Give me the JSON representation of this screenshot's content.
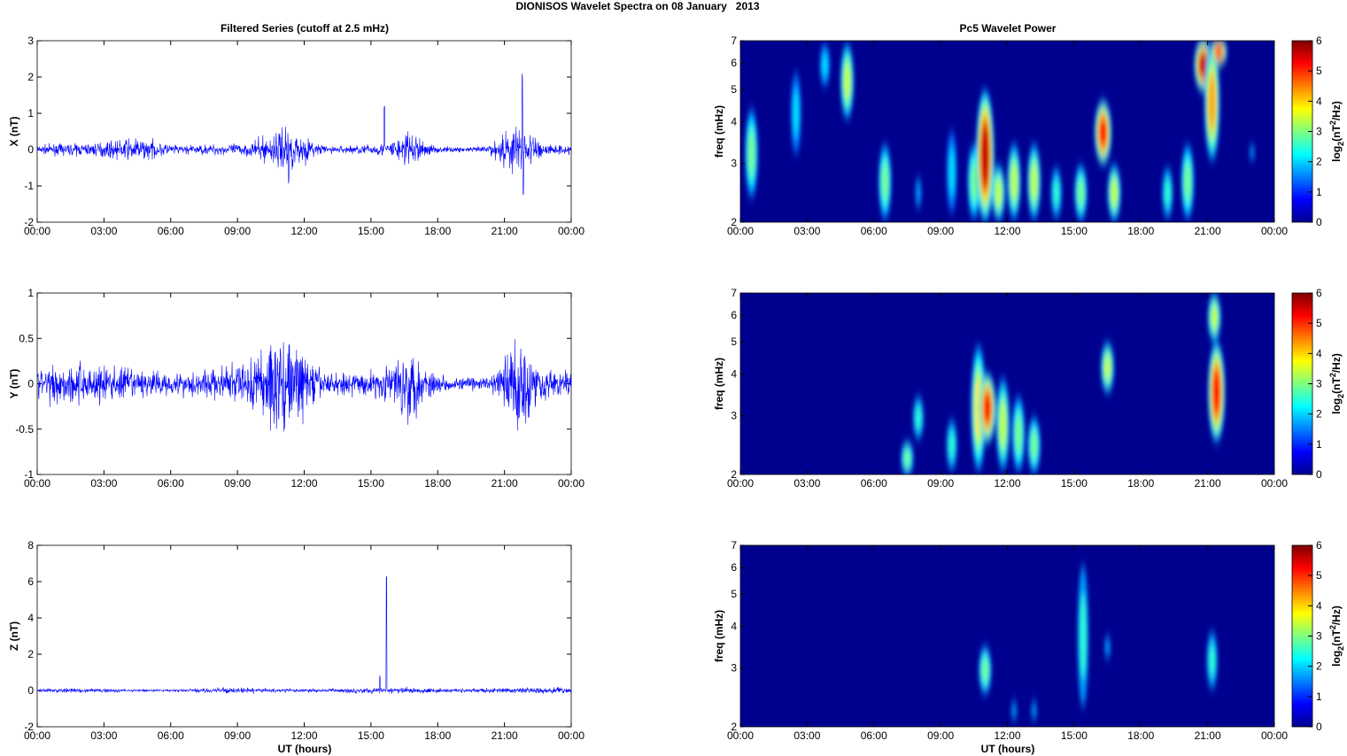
{
  "title": "DIONISOS Wavelet Spectra on 08 January   2013",
  "chart_data": {
    "left_title": "Filtered Series (cutoff at 2.5 mHz)",
    "right_title": "Pc5 Wavelet Power",
    "xlabel": "UT (hours)",
    "xticks": [
      "00:00",
      "03:00",
      "06:00",
      "09:00",
      "12:00",
      "15:00",
      "18:00",
      "21:00",
      "00:00"
    ],
    "xlim_hours": [
      0,
      24
    ],
    "freq_label": "freq (mHz)",
    "freq_ticks": [
      "2",
      "3",
      "4",
      "5",
      "6",
      "7"
    ],
    "freq_lim": [
      2,
      7
    ],
    "colorbar_label": "log2(nT2/Hz)",
    "colorbar_ticks": [
      "0",
      "1",
      "2",
      "3",
      "4",
      "5",
      "6"
    ],
    "colorbar_lim": [
      0,
      6
    ],
    "colormap": "jet",
    "line_color": "#0000ff",
    "panels": [
      {
        "component": "X",
        "ylabel": "X (nT)",
        "ylim": [
          -2,
          3
        ],
        "yticks": [
          "-2",
          "-1",
          "0",
          "1",
          "2",
          "3"
        ],
        "noise": 0.1,
        "bursts": [
          [
            11.2,
            0.8,
            0.45
          ],
          [
            15.6,
            0.02,
            1.1
          ],
          [
            16.7,
            0.5,
            0.3
          ],
          [
            21.5,
            0.6,
            0.5
          ],
          [
            21.8,
            0.05,
            2.0
          ],
          [
            21.85,
            0.05,
            -1.1
          ],
          [
            11.3,
            0.05,
            -0.9
          ],
          [
            4.5,
            1,
            0.2
          ]
        ],
        "spectrum": [
          [
            0.5,
            2.3,
            4.5,
            2.5
          ],
          [
            2.5,
            3,
            6,
            1.5
          ],
          [
            3.8,
            5,
            7,
            1.5
          ],
          [
            4.8,
            4,
            7,
            3
          ],
          [
            6.5,
            2,
            3.5,
            2.5
          ],
          [
            8,
            2,
            3,
            1
          ],
          [
            9.5,
            2,
            4,
            1.5
          ],
          [
            10.5,
            2,
            3.5,
            2.5
          ],
          [
            11,
            2,
            5,
            5.5
          ],
          [
            11.6,
            2,
            3,
            3
          ],
          [
            12.3,
            2,
            3.5,
            3
          ],
          [
            13.2,
            2,
            3.5,
            3
          ],
          [
            14.2,
            2,
            3,
            2
          ],
          [
            15.3,
            2,
            3,
            2.5
          ],
          [
            16.3,
            3,
            4.6,
            5
          ],
          [
            16.8,
            2,
            3,
            3
          ],
          [
            19.2,
            2,
            3,
            2
          ],
          [
            20.1,
            2,
            3.5,
            2.5
          ],
          [
            20.8,
            5,
            7,
            5.5
          ],
          [
            21.2,
            3,
            7,
            4
          ],
          [
            21.5,
            6,
            7,
            5
          ],
          [
            23,
            3,
            3.5,
            1
          ]
        ]
      },
      {
        "component": "Y",
        "ylabel": "Y (nT)",
        "ylim": [
          -1,
          1
        ],
        "yticks": [
          "-1",
          "-0.5",
          "0",
          "0.5",
          "1"
        ],
        "noise": 0.1,
        "bursts": [
          [
            11.0,
            1.0,
            0.4
          ],
          [
            16.8,
            0.5,
            0.25
          ],
          [
            21.6,
            0.5,
            0.4
          ],
          [
            3,
            3,
            0.08
          ]
        ],
        "spectrum": [
          [
            7.5,
            2,
            2.5,
            2.5
          ],
          [
            8,
            2.5,
            3.5,
            2
          ],
          [
            9.5,
            2,
            3,
            2
          ],
          [
            10.7,
            2,
            5,
            3.5
          ],
          [
            11.1,
            2.5,
            4,
            5
          ],
          [
            11.8,
            2,
            4,
            3
          ],
          [
            12.5,
            2,
            3.5,
            2.5
          ],
          [
            13.2,
            2,
            3,
            2.5
          ],
          [
            16.5,
            3.5,
            5,
            3
          ],
          [
            21.4,
            2.5,
            5,
            5
          ],
          [
            21.3,
            5,
            7,
            3
          ]
        ]
      },
      {
        "component": "Z",
        "ylabel": "Z (nT)",
        "ylim": [
          -2,
          8
        ],
        "yticks": [
          "-2",
          "0",
          "2",
          "4",
          "6",
          "8"
        ],
        "noise": 0.08,
        "bursts": [
          [
            15.7,
            0.02,
            6.2
          ],
          [
            15.4,
            0.03,
            0.8
          ],
          [
            18,
            6,
            0.05
          ]
        ],
        "spectrum": [
          [
            11,
            2.5,
            3.5,
            2.5
          ],
          [
            12.3,
            2,
            2.5,
            1
          ],
          [
            13.2,
            2,
            2.5,
            1
          ],
          [
            15.4,
            2,
            7,
            2
          ],
          [
            16.5,
            3,
            4,
            1
          ],
          [
            21.2,
            2.5,
            4,
            2
          ]
        ]
      }
    ]
  }
}
